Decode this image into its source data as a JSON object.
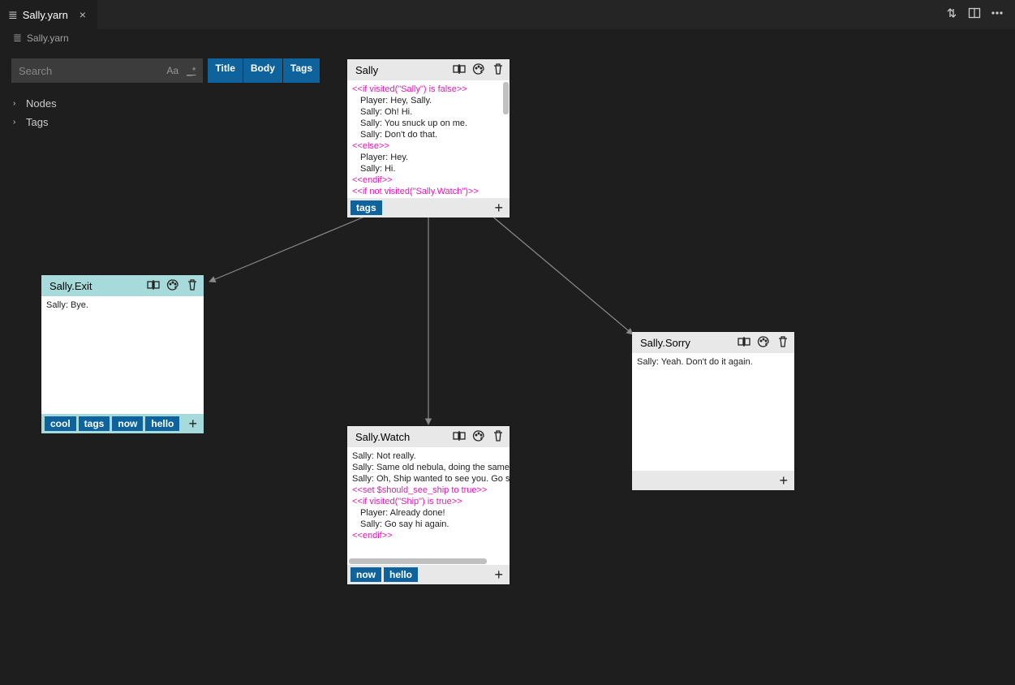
{
  "tab": {
    "filename": "Sally.yarn"
  },
  "breadcrumb": {
    "filename": "Sally.yarn"
  },
  "sidebar": {
    "search_placeholder": "Search",
    "filters": {
      "title": "Title",
      "body": "Body",
      "tags": "Tags"
    },
    "tree": {
      "nodes_label": "Nodes",
      "tags_label": "Tags"
    }
  },
  "nodes": {
    "sally": {
      "title": "Sally",
      "lines": [
        {
          "t": "cmd",
          "v": "<<if visited(\"Sally\") is false>>"
        },
        {
          "t": "ind",
          "v": "Player: Hey, Sally."
        },
        {
          "t": "ind",
          "v": "Sally: Oh! Hi."
        },
        {
          "t": "ind",
          "v": "Sally: You snuck up on me."
        },
        {
          "t": "ind",
          "v": "Sally: Don't do that."
        },
        {
          "t": "cmd",
          "v": "<<else>>"
        },
        {
          "t": "ind",
          "v": "Player: Hey."
        },
        {
          "t": "ind",
          "v": "Sally: Hi."
        },
        {
          "t": "cmd",
          "v": "<<endif>>"
        },
        {
          "t": "cmd",
          "v": "<<if not visited(\"Sally.Watch\")>>"
        }
      ],
      "tags": [
        "tags"
      ]
    },
    "exit": {
      "title": "Sally.Exit",
      "lines": [
        {
          "t": "txt",
          "v": "Sally: Bye."
        }
      ],
      "tags": [
        "cool",
        "tags",
        "now",
        "hello"
      ]
    },
    "watch": {
      "title": "Sally.Watch",
      "lines": [
        {
          "t": "txt",
          "v": "Sally: Not really."
        },
        {
          "t": "txt",
          "v": "Sally: Same old nebula, doing the same old t"
        },
        {
          "t": "txt",
          "v": "Sally: Oh, Ship wanted to see you. Go say hi"
        },
        {
          "t": "cmd",
          "v": "<<set $should_see_ship to true>>"
        },
        {
          "t": "cmd",
          "v": "<<if visited(\"Ship\") is true>>"
        },
        {
          "t": "ind",
          "v": "Player: Already done!"
        },
        {
          "t": "ind",
          "v": "Sally: Go say hi again."
        },
        {
          "t": "cmd",
          "v": "<<endif>>"
        }
      ],
      "tags": [
        "now",
        "hello"
      ]
    },
    "sorry": {
      "title": "Sally.Sorry",
      "lines": [
        {
          "t": "txt",
          "v": "Sally: Yeah. Don't do it again."
        }
      ],
      "tags": []
    }
  }
}
